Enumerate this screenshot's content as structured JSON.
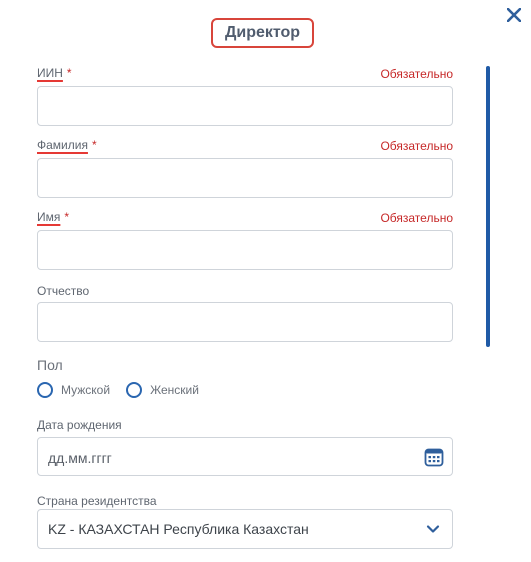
{
  "dialog": {
    "title": "Директор",
    "required_text": "Обязательно"
  },
  "fields": {
    "iin": {
      "label": "ИИН",
      "required_mark": "*",
      "value": ""
    },
    "surname": {
      "label": "Фамилия",
      "required_mark": "*",
      "value": ""
    },
    "name": {
      "label": "Имя",
      "required_mark": "*",
      "value": ""
    },
    "patronymic": {
      "label": "Отчество",
      "value": ""
    }
  },
  "gender": {
    "label": "Пол",
    "options": [
      "Мужской",
      "Женский"
    ]
  },
  "birth_date": {
    "label": "Дата рождения",
    "placeholder": "дд.мм.гггг"
  },
  "residence_country": {
    "label": "Страна резидентства",
    "selected": "KZ - КАЗАХСТАН Республика Казахстан"
  },
  "colors": {
    "accent": "#1f5aa6",
    "required": "#c62828",
    "highlight": "#d8453b"
  },
  "icons": {
    "close": "close-icon",
    "calendar": "calendar-icon",
    "dropdown": "chevron-down-icon"
  }
}
